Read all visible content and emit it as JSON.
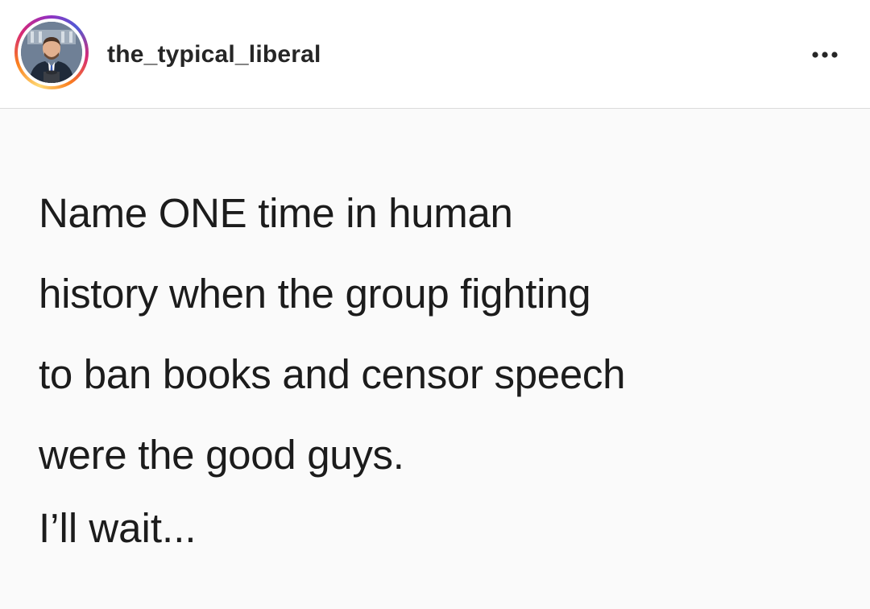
{
  "header": {
    "username": "the_typical_liberal",
    "avatar_icon": "profile-photo",
    "more_icon": "more-horizontal-icon",
    "ring_colors": [
      "#feda75",
      "#fa7e1e",
      "#d62976",
      "#962fbf",
      "#4f5bd5"
    ]
  },
  "post": {
    "lines": [
      "Name ONE time in human",
      "history when the group fighting",
      "to ban books and censor speech",
      "were the good guys."
    ],
    "closing": "I’ll wait..."
  }
}
